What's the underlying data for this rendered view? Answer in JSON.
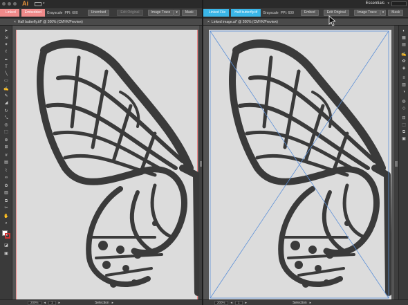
{
  "left": {
    "app_logo": "Ai",
    "ctrl": {
      "tag1": "Linked",
      "tag2": "Embedded",
      "colormode": "Grayscale",
      "ppi": "PPI: 600",
      "unembed_label": "Unembed",
      "edit_original_label": "Edit Original",
      "image_trace_label": "Image Trace",
      "mask_label": "Mask"
    },
    "doc_tab": "Half butterfly.tif* @ 200% (CMYK/Preview)",
    "status": {
      "zoom": "200%",
      "page": "1",
      "mode": "Selection"
    }
  },
  "right": {
    "workspace": "Essentials",
    "ctrl": {
      "tag1": "Linked File",
      "tag2": "Half butterfly.tif",
      "colormode": "Grayscale",
      "ppi": "PPI: 600",
      "embed_label": "Embed",
      "edit_original_label": "Edit Original",
      "image_trace_label": "Image Trace",
      "mask_label": "Mask"
    },
    "doc_tab": "Linked image.ai* @ 200% (CMYK/Preview)",
    "status": {
      "zoom": "200%",
      "page": "1",
      "mode": "Selection"
    }
  },
  "colors": {
    "linked_tag": "#f08a8a",
    "linked_file_tag": "#3ab6e8",
    "artwork": "#3a3a3a",
    "artboard": "#dcdcdc",
    "bounding_box": "#5a8fd8"
  },
  "icons": [
    "arrow-icon",
    "direct-select-icon",
    "magic-wand-icon",
    "lasso-icon",
    "pen-icon",
    "type-icon",
    "line-icon",
    "rectangle-icon",
    "paintbrush-icon",
    "pencil-icon",
    "eraser-icon",
    "rotate-icon",
    "scale-icon",
    "warp-icon",
    "free-transform-icon",
    "shape-builder-icon",
    "perspective-icon",
    "mesh-icon",
    "gradient-icon",
    "eyedropper-icon",
    "blend-icon",
    "symbol-sprayer-icon",
    "graph-icon",
    "artboard-icon",
    "slice-icon",
    "hand-icon",
    "zoom-icon",
    "fill-stroke-icon",
    "drawing-modes-icon",
    "screen-mode-icon"
  ]
}
